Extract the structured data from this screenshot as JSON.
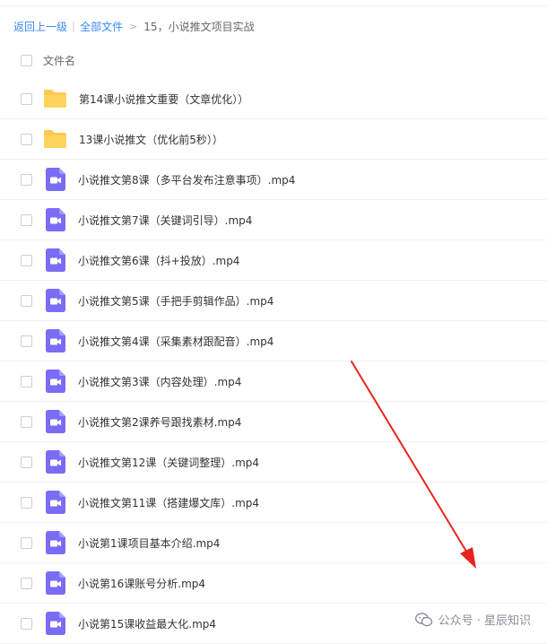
{
  "breadcrumb": {
    "back": "返回上一级",
    "separator": "|",
    "all_files": "全部文件",
    "arrow": ">",
    "current": "15，小说推文项目实战"
  },
  "header": {
    "name_label": "文件名"
  },
  "files": [
    {
      "type": "folder",
      "name": "第14课小说推文重要（文章优化））"
    },
    {
      "type": "folder",
      "name": "13课小说推文（优化前5秒））"
    },
    {
      "type": "video",
      "name": "小说推文第8课（多平台发布注意事项）.mp4"
    },
    {
      "type": "video",
      "name": "小说推文第7课（关键词引导）.mp4"
    },
    {
      "type": "video",
      "name": "小说推文第6课（抖+投放）.mp4"
    },
    {
      "type": "video",
      "name": "小说推文第5课（手把手剪辑作品）.mp4"
    },
    {
      "type": "video",
      "name": "小说推文第4课（采集素材跟配音）.mp4"
    },
    {
      "type": "video",
      "name": "小说推文第3课（内容处理）.mp4"
    },
    {
      "type": "video",
      "name": "小说推文第2课养号跟找素材.mp4"
    },
    {
      "type": "video",
      "name": "小说推文第12课（关键词整理）.mp4"
    },
    {
      "type": "video",
      "name": "小说推文第11课（搭建爆文库）.mp4"
    },
    {
      "type": "video",
      "name": "小说第1课项目基本介绍.mp4"
    },
    {
      "type": "video",
      "name": "小说第16课账号分析.mp4"
    },
    {
      "type": "video",
      "name": "小说第15课收益最大化.mp4"
    }
  ],
  "watermark": {
    "text": "公众号 · 星辰知识"
  },
  "colors": {
    "link": "#3b88f5",
    "folder": "#ffc94d",
    "video": "#7b6cf6",
    "annotation_arrow": "#e8231d"
  }
}
